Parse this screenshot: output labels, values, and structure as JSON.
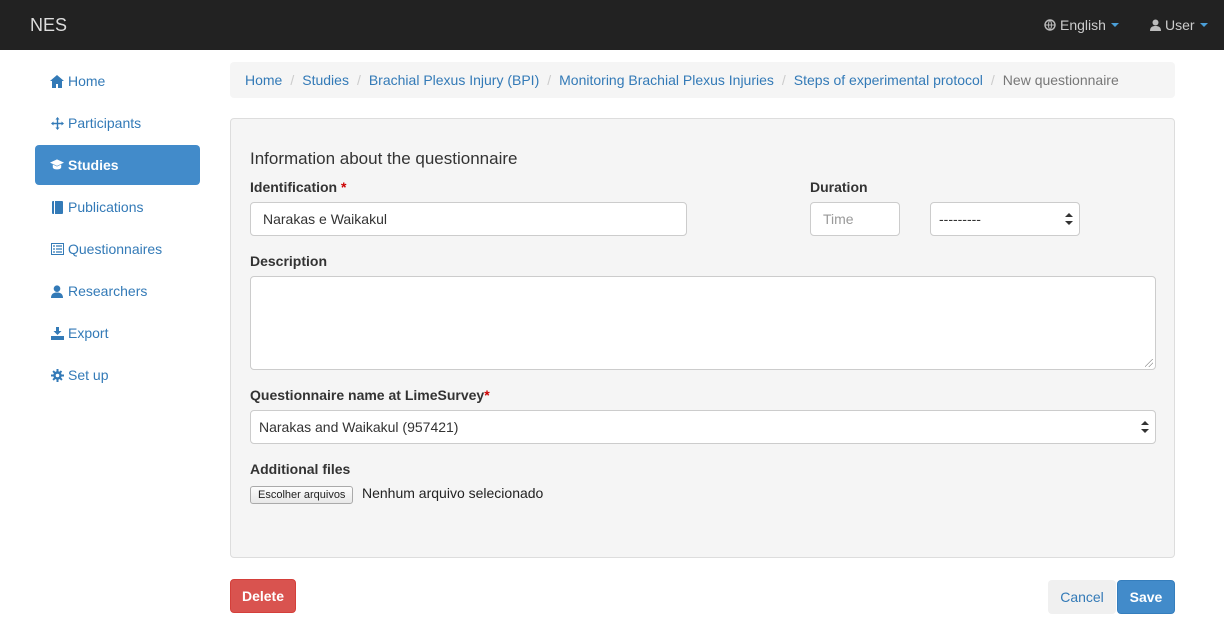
{
  "navbar": {
    "brand": "NES",
    "language": "English",
    "user": "User"
  },
  "sidebar": {
    "items": [
      {
        "label": "Home",
        "icon": "home-icon"
      },
      {
        "label": "Participants",
        "icon": "move-icon"
      },
      {
        "label": "Studies",
        "icon": "graduation-cap-icon",
        "active": true
      },
      {
        "label": "Publications",
        "icon": "book-icon"
      },
      {
        "label": "Questionnaires",
        "icon": "list-alt-icon"
      },
      {
        "label": "Researchers",
        "icon": "user-icon"
      },
      {
        "label": "Export",
        "icon": "export-icon"
      },
      {
        "label": "Set up",
        "icon": "cog-icon"
      }
    ]
  },
  "breadcrumb": [
    "Home",
    "Studies",
    "Brachial Plexus Injury (BPI)",
    "Monitoring Brachial Plexus Injuries",
    "Steps of experimental protocol",
    "New questionnaire"
  ],
  "form": {
    "title": "Information about the questionnaire",
    "identification_label": "Identification",
    "identification_value": "Narakas e Waikakul",
    "duration_label": "Duration",
    "duration_placeholder": "Time",
    "duration_unit": "---------",
    "description_label": "Description",
    "description_value": "",
    "limesurvey_label": "Questionnaire name at LimeSurvey",
    "limesurvey_value": "Narakas and Waikakul (957421)",
    "files_label": "Additional files",
    "file_button": "Escolher arquivos",
    "file_status": "Nenhum arquivo selecionado",
    "required_mark": "*"
  },
  "actions": {
    "delete": "Delete",
    "cancel": "Cancel",
    "save": "Save"
  },
  "colors": {
    "navbar": "#222222",
    "primary": "#428bca",
    "danger": "#d9534f",
    "link": "#337ab7"
  }
}
